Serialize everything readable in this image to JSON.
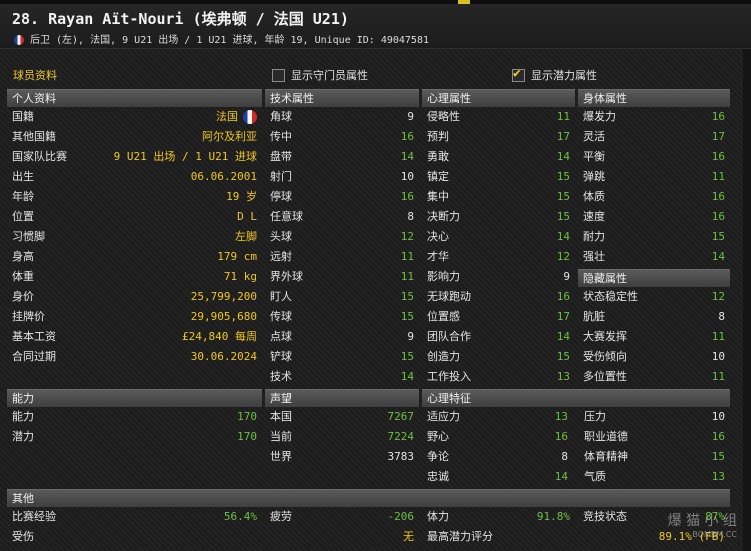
{
  "header": {
    "title": "28. Rayan Aït-Nouri (埃弗顿 / 法国 U21)",
    "subtitle": "后卫 (左), 法国, 9 U21 出场 / 1 U21 进球, 年龄 19, Unique ID: 49047581"
  },
  "toolbar": {
    "section_label": "球员资料",
    "gk_toggle": {
      "label": "显示守门员属性",
      "checked": false
    },
    "potential_toggle": {
      "label": "显示潜力属性",
      "checked": true
    }
  },
  "colors": {
    "accent": "#f0c820",
    "green": "#6cc040",
    "header_bg": "#4a4a4a"
  },
  "personal": {
    "title": "个人资料",
    "rows": [
      {
        "label": "国籍",
        "value": "法国",
        "flag": "france-flag-icon"
      },
      {
        "label": "其他国籍",
        "value": "阿尔及利亚"
      },
      {
        "label": "国家队比赛",
        "value": "9 U21 出场 / 1 U21 进球"
      },
      {
        "label": "出生",
        "value": "06.06.2001"
      },
      {
        "label": "年龄",
        "value": "19 岁"
      },
      {
        "label": "位置",
        "value": "D L"
      },
      {
        "label": "习惯脚",
        "value": "左脚"
      },
      {
        "label": "身高",
        "value": "179 cm"
      },
      {
        "label": "体重",
        "value": "71 kg"
      },
      {
        "label": "身价",
        "value": "25,799,200"
      },
      {
        "label": "挂牌价",
        "value": "29,905,680"
      },
      {
        "label": "基本工资",
        "value": "£24,840 每周"
      },
      {
        "label": "合同过期",
        "value": "30.06.2024"
      }
    ]
  },
  "technical": {
    "title": "技术属性",
    "rows": [
      {
        "label": "角球",
        "value": "9",
        "c": "w"
      },
      {
        "label": "传中",
        "value": "16",
        "c": "g"
      },
      {
        "label": "盘带",
        "value": "14",
        "c": "g"
      },
      {
        "label": "射门",
        "value": "10",
        "c": "w"
      },
      {
        "label": "停球",
        "value": "16",
        "c": "g"
      },
      {
        "label": "任意球",
        "value": "8",
        "c": "w"
      },
      {
        "label": "头球",
        "value": "12",
        "c": "g"
      },
      {
        "label": "远射",
        "value": "11",
        "c": "g"
      },
      {
        "label": "界外球",
        "value": "11",
        "c": "g"
      },
      {
        "label": "盯人",
        "value": "15",
        "c": "g"
      },
      {
        "label": "传球",
        "value": "15",
        "c": "g"
      },
      {
        "label": "点球",
        "value": "9",
        "c": "w"
      },
      {
        "label": "铲球",
        "value": "15",
        "c": "g"
      },
      {
        "label": "技术",
        "value": "14",
        "c": "g"
      }
    ]
  },
  "mental": {
    "title": "心理属性",
    "rows": [
      {
        "label": "侵略性",
        "value": "11",
        "c": "g"
      },
      {
        "label": "预判",
        "value": "17",
        "c": "g"
      },
      {
        "label": "勇敢",
        "value": "14",
        "c": "g"
      },
      {
        "label": "镇定",
        "value": "15",
        "c": "g"
      },
      {
        "label": "集中",
        "value": "15",
        "c": "g"
      },
      {
        "label": "决断力",
        "value": "15",
        "c": "g"
      },
      {
        "label": "决心",
        "value": "14",
        "c": "g"
      },
      {
        "label": "才华",
        "value": "12",
        "c": "g"
      },
      {
        "label": "影响力",
        "value": "9",
        "c": "w"
      },
      {
        "label": "无球跑动",
        "value": "16",
        "c": "g"
      },
      {
        "label": "位置感",
        "value": "17",
        "c": "g"
      },
      {
        "label": "团队合作",
        "value": "14",
        "c": "g"
      },
      {
        "label": "创造力",
        "value": "15",
        "c": "g"
      },
      {
        "label": "工作投入",
        "value": "13",
        "c": "g"
      }
    ]
  },
  "physical": {
    "title": "身体属性",
    "rows": [
      {
        "label": "爆发力",
        "value": "16",
        "c": "g"
      },
      {
        "label": "灵活",
        "value": "17",
        "c": "g"
      },
      {
        "label": "平衡",
        "value": "16",
        "c": "g"
      },
      {
        "label": "弹跳",
        "value": "11",
        "c": "g"
      },
      {
        "label": "体质",
        "value": "16",
        "c": "g"
      },
      {
        "label": "速度",
        "value": "16",
        "c": "g"
      },
      {
        "label": "耐力",
        "value": "15",
        "c": "g"
      },
      {
        "label": "强壮",
        "value": "14",
        "c": "g"
      }
    ]
  },
  "hidden": {
    "title": "隐藏属性",
    "rows": [
      {
        "label": "状态稳定性",
        "value": "12",
        "c": "g"
      },
      {
        "label": "肮脏",
        "value": "8",
        "c": "w"
      },
      {
        "label": "大赛发挥",
        "value": "11",
        "c": "g"
      },
      {
        "label": "受伤倾向",
        "value": "10",
        "c": "w"
      },
      {
        "label": "多位置性",
        "value": "11",
        "c": "g"
      }
    ]
  },
  "ability": {
    "title": "能力",
    "rows": [
      {
        "label": "能力",
        "value": "170",
        "c": "g"
      },
      {
        "label": "潜力",
        "value": "170",
        "c": "g"
      }
    ]
  },
  "reputation": {
    "title": "声望",
    "rows": [
      {
        "label": "本国",
        "value": "7267",
        "c": "g"
      },
      {
        "label": "当前",
        "value": "7224",
        "c": "g"
      },
      {
        "label": "世界",
        "value": "3783",
        "c": "w"
      }
    ]
  },
  "traits": {
    "title": "心理特征",
    "rows": [
      {
        "label": "适应力",
        "value": "13",
        "c": "g"
      },
      {
        "label": "野心",
        "value": "16",
        "c": "g"
      },
      {
        "label": "争论",
        "value": "8",
        "c": "w"
      },
      {
        "label": "忠诚",
        "value": "14",
        "c": "g"
      }
    ]
  },
  "traits2": {
    "rows": [
      {
        "label": "压力",
        "value": "10",
        "c": "w"
      },
      {
        "label": "职业道德",
        "value": "16",
        "c": "g"
      },
      {
        "label": "体育精神",
        "value": "15",
        "c": "g"
      },
      {
        "label": "气质",
        "value": "13",
        "c": "g"
      }
    ]
  },
  "other": {
    "title": "其他",
    "row1": [
      {
        "label": "比赛经验",
        "value": "56.4%",
        "c": "g"
      },
      {
        "label": "疲劳",
        "value": "-206",
        "c": "g"
      },
      {
        "label": "体力",
        "value": "91.8%",
        "c": "g"
      },
      {
        "label": "竞技状态",
        "value": "87%",
        "c": "g"
      }
    ],
    "row2": [
      {
        "label": "受伤",
        "value": "",
        "c": "w"
      },
      {
        "label": "",
        "value": "无",
        "c": "y"
      },
      {
        "label": "最高潜力评分",
        "value": "",
        "c": "w"
      },
      {
        "label": "",
        "value": "89.1% (FB)",
        "c": "y"
      }
    ]
  },
  "watermark": {
    "text": "爆 猫 小 组",
    "sub": "BOMBM.CC"
  }
}
